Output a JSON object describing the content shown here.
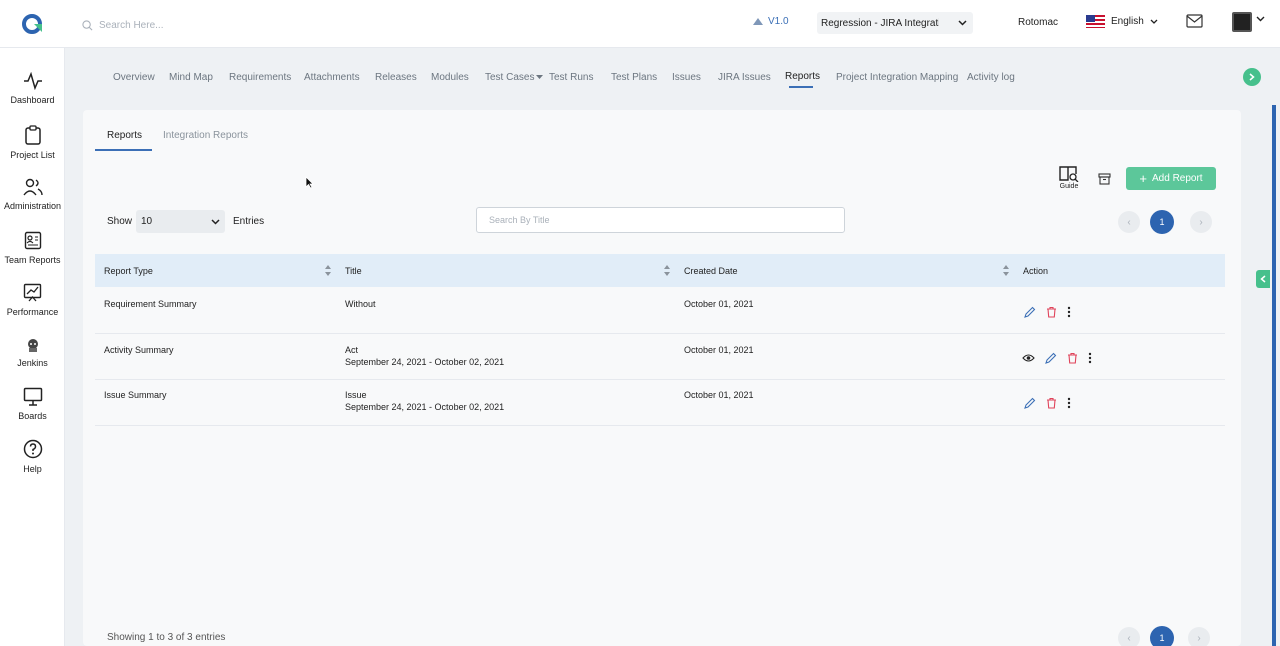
{
  "header": {
    "search_placeholder": "Search Here...",
    "version": "V1.0",
    "project": "Regression - JIRA Integration",
    "user": "Rotomac",
    "language": "English"
  },
  "sidebar": {
    "items": [
      {
        "label": "Dashboard",
        "icon": "pulse-icon"
      },
      {
        "label": "Project List",
        "icon": "clipboard-icon"
      },
      {
        "label": "Administration",
        "icon": "users-icon"
      },
      {
        "label": "Team Reports",
        "icon": "report-icon"
      },
      {
        "label": "Performance",
        "icon": "chart-icon"
      },
      {
        "label": "Jenkins",
        "icon": "jenkins-icon"
      },
      {
        "label": "Boards",
        "icon": "board-icon"
      },
      {
        "label": "Help",
        "icon": "help-icon"
      }
    ]
  },
  "modules": {
    "items": [
      "Overview",
      "Mind Map",
      "Requirements",
      "Attachments",
      "Releases",
      "Modules",
      "Test Cases",
      "Test Runs",
      "Test Plans",
      "Issues",
      "JIRA Issues",
      "Reports",
      "Project Integration Mapping",
      "Activity log"
    ],
    "active": "Reports"
  },
  "tabs": {
    "reports": "Reports",
    "integration": "Integration Reports"
  },
  "toolbar": {
    "guide_label": "Guide",
    "add_report_label": "Add Report"
  },
  "filters": {
    "show_label": "Show",
    "entries_value": "10",
    "entries_label": "Entries",
    "search_placeholder": "Search By Title"
  },
  "pagination": {
    "prev": "‹",
    "current": "1",
    "next": "›"
  },
  "table": {
    "columns": [
      "Report Type",
      "Title",
      "Created Date",
      "Action"
    ],
    "rows": [
      {
        "type": "Requirement Summary",
        "title": "Without",
        "subtitle": "",
        "created": "October 01, 2021",
        "view": false
      },
      {
        "type": "Activity Summary",
        "title": "Act",
        "subtitle": "September 24, 2021 - October 02, 2021",
        "created": "October 01, 2021",
        "view": true
      },
      {
        "type": "Issue Summary",
        "title": "Issue",
        "subtitle": "September 24, 2021 - October 02, 2021",
        "created": "October 01, 2021",
        "view": false
      }
    ]
  },
  "footer": {
    "info": "Showing 1 to 3 of 3 entries"
  },
  "colors": {
    "accent": "#2d64b0",
    "green": "#5cc79a",
    "delete": "#e0435a"
  }
}
